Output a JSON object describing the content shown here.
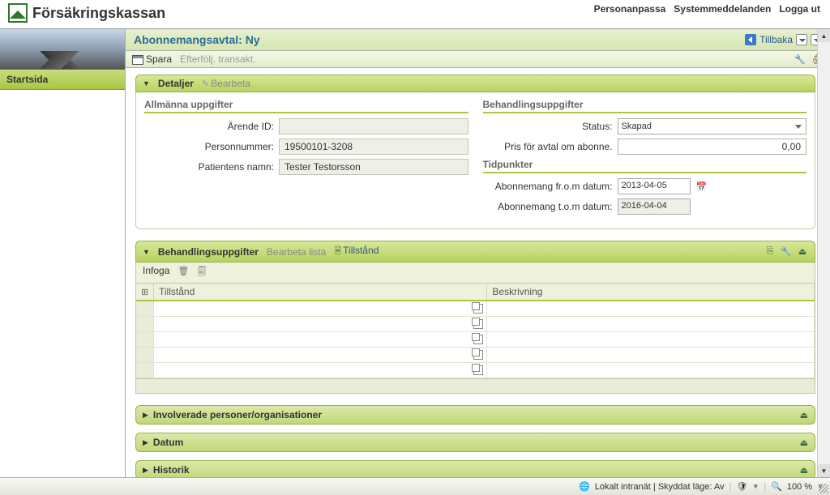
{
  "header": {
    "brand": "Försäkringskassan",
    "links": {
      "personalize": "Personanpassa",
      "messages": "Systemmeddelanden",
      "logout": "Logga ut"
    }
  },
  "sidebar": {
    "start": "Startsida"
  },
  "titlebar": {
    "title": "Abonnemangsavtal: Ny",
    "back": "Tillbaka"
  },
  "toolbar": {
    "save": "Spara",
    "followup": "Efterfölj. transakt."
  },
  "details": {
    "panel_title": "Detaljer",
    "edit": "Bearbeta",
    "general": {
      "heading": "Allmänna uppgifter",
      "labels": {
        "case_id": "Ärende ID:",
        "person_number": "Personnummer:",
        "patient_name": "Patientens namn:"
      },
      "values": {
        "case_id": "",
        "person_number": "19500101-3208",
        "patient_name": "Tester Testorsson"
      }
    },
    "treatment": {
      "heading": "Behandlingsuppgifter",
      "labels": {
        "status": "Status:",
        "price": "Pris för avtal om abonne."
      },
      "values": {
        "status": "Skapad",
        "price": "0,00"
      }
    },
    "times": {
      "heading": "Tidpunkter",
      "labels": {
        "from": "Abonnemang fr.o.m datum:",
        "to": "Abonnemang t.o.m datum:"
      },
      "values": {
        "from": "2013-04-05",
        "to": "2016-04-04"
      }
    }
  },
  "treatment_panel": {
    "title": "Behandlingsuppgifter",
    "list_action": "Bearbeta lista",
    "condition_action": "Tillstånd",
    "subtoolbar": {
      "insert": "Infoga"
    },
    "columns": {
      "condition": "Tillstånd",
      "description": "Beskrivning"
    }
  },
  "collapsed": {
    "involved": "Involverade personer/organisationer",
    "date": "Datum",
    "history": "Historik"
  },
  "statusbar": {
    "zone": "Lokalt intranät | Skyddat läge: Av",
    "zoom": "100 %"
  }
}
